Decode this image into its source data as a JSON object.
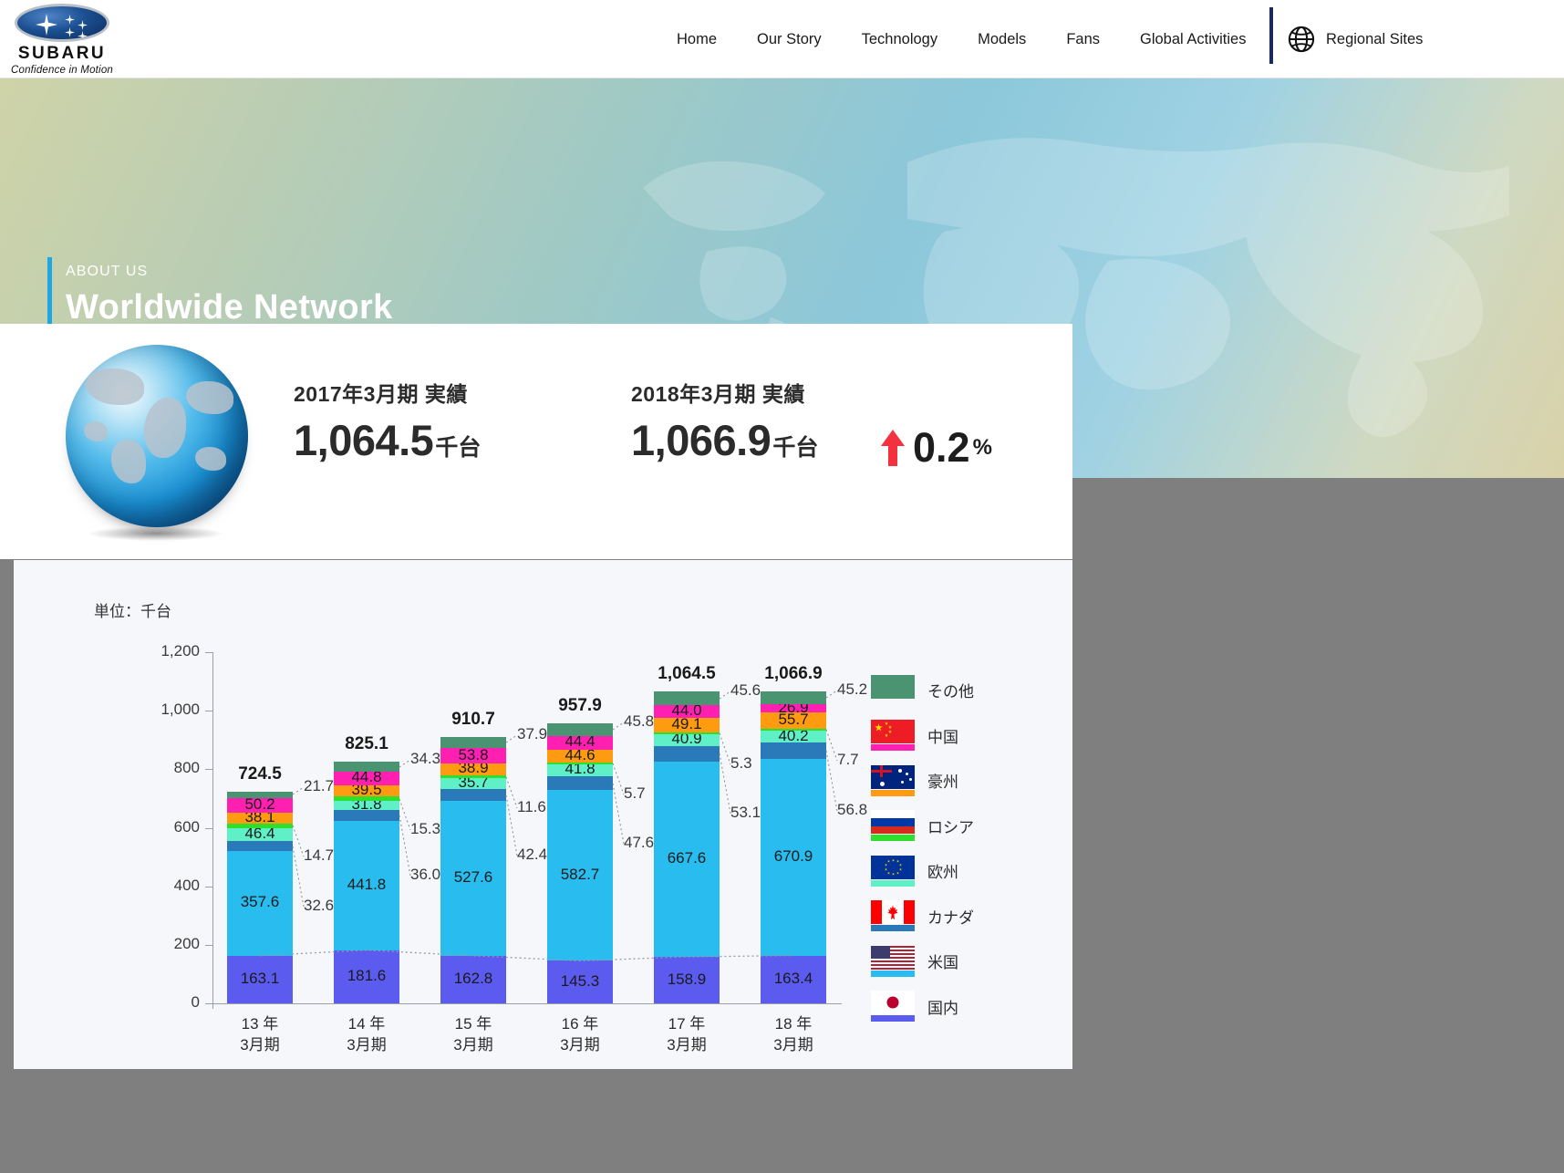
{
  "header": {
    "logo": {
      "wordmark": "SUBARU",
      "tagline": "Confidence in Motion"
    },
    "nav": [
      {
        "label": "Home"
      },
      {
        "label": "Our Story"
      },
      {
        "label": "Technology"
      },
      {
        "label": "Models"
      },
      {
        "label": "Fans"
      },
      {
        "label": "Global Activities"
      }
    ],
    "regional": {
      "label": "Regional Sites",
      "icon": "globe-icon"
    }
  },
  "hero": {
    "kicker": "ABOUT US",
    "title": "Worldwide Network"
  },
  "stats": {
    "left": {
      "label": "2017年3月期 実績",
      "value": "1,064.5",
      "unit": "千台"
    },
    "right": {
      "label": "2018年3月期 実績",
      "value": "1,066.9",
      "unit": "千台"
    },
    "delta": {
      "direction": "up",
      "value": "0.2",
      "unit": "%"
    }
  },
  "chart_panel": {
    "unit_note": "単位：千台"
  },
  "chart_data": {
    "type": "bar",
    "stacked": true,
    "title": "",
    "xlabel": "",
    "ylabel": "",
    "unit": "千台",
    "ylim": [
      0,
      1200
    ],
    "yticks": [
      0,
      200,
      400,
      600,
      800,
      1000,
      1200
    ],
    "ytick_labels": [
      "0",
      "200",
      "400",
      "600",
      "800",
      "1,000",
      "1,200"
    ],
    "grid": false,
    "legend_position": "right",
    "categories": [
      "13年\n3月期",
      "14年\n3月期",
      "15年\n3月期",
      "16年\n3月期",
      "17年\n3月期",
      "18年\n3月期"
    ],
    "category_lines": [
      [
        "13 年",
        "3月期"
      ],
      [
        "14 年",
        "3月期"
      ],
      [
        "15 年",
        "3月期"
      ],
      [
        "16 年",
        "3月期"
      ],
      [
        "17 年",
        "3月期"
      ],
      [
        "18 年",
        "3月期"
      ]
    ],
    "totals": [
      "724.5",
      "825.1",
      "910.7",
      "957.9",
      "1,064.5",
      "1,066.9"
    ],
    "totals_numeric": [
      724.5,
      825.1,
      910.7,
      957.9,
      1064.5,
      1066.9
    ],
    "series": [
      {
        "name": "国内",
        "legend": "国内",
        "color": "#5b5bf0",
        "flag": "jp-flag-icon",
        "values": [
          163.1,
          181.6,
          162.8,
          145.3,
          158.9,
          163.4
        ],
        "labels": [
          "163.1",
          "181.6",
          "162.8",
          "145.3",
          "158.9",
          "163.4"
        ]
      },
      {
        "name": "米国",
        "legend": "米国",
        "color": "#29bdef",
        "flag": "us-flag-icon",
        "values": [
          357.6,
          441.8,
          527.6,
          582.7,
          667.6,
          670.9
        ],
        "labels": [
          "357.6",
          "441.8",
          "527.6",
          "582.7",
          "667.6",
          "670.9"
        ]
      },
      {
        "name": "カナダ",
        "legend": "カナダ",
        "color": "#2a7ab9",
        "flag": "ca-flag-icon",
        "values": [
          32.6,
          36.0,
          42.4,
          47.6,
          53.1,
          56.8
        ],
        "labels": [
          "32.6",
          "36.0",
          "42.4",
          "47.6",
          "53.1",
          "56.8"
        ]
      },
      {
        "name": "欧州",
        "legend": "欧州",
        "color": "#5ff0c8",
        "flag": "eu-flag-icon",
        "values": [
          46.4,
          31.8,
          35.7,
          41.8,
          40.9,
          40.2
        ],
        "labels": [
          "46.4",
          "31.8",
          "35.7",
          "41.8",
          "40.9",
          "40.2"
        ]
      },
      {
        "name": "ロシア",
        "legend": "ロシア",
        "color": "#2ee02e",
        "flag": "ru-flag-icon",
        "values": [
          14.7,
          15.3,
          11.6,
          5.7,
          5.3,
          7.7
        ],
        "labels": [
          "14.7",
          "15.3",
          "11.6",
          "5.7",
          "5.3",
          "7.7"
        ]
      },
      {
        "name": "豪州",
        "legend": "豪州",
        "color": "#ff9b11",
        "flag": "au-flag-icon",
        "values": [
          38.1,
          39.5,
          38.9,
          44.6,
          49.1,
          55.7
        ],
        "labels": [
          "38.1",
          "39.5",
          "38.9",
          "44.6",
          "49.1",
          "55.7"
        ]
      },
      {
        "name": "中国",
        "legend": "中国",
        "color": "#ff20b2",
        "flag": "cn-flag-icon",
        "values": [
          50.2,
          44.8,
          53.8,
          44.4,
          44.0,
          26.9
        ],
        "labels": [
          "50.2",
          "44.8",
          "53.8",
          "44.4",
          "44.0",
          "26.9"
        ]
      },
      {
        "name": "その他",
        "legend": "その他",
        "color": "#4a9471",
        "flag": "other-swatch-icon",
        "values": [
          21.7,
          34.3,
          37.9,
          45.8,
          45.6,
          45.2
        ],
        "labels": [
          "21.7",
          "34.3",
          "37.9",
          "45.8",
          "45.6",
          "45.2"
        ]
      }
    ],
    "notes": "Stacked column chart of SUBARU worldwide unit sales by region, FY2013-FY2018 (thousands of units). Small segments are labelled with leader lines outside the bar."
  }
}
